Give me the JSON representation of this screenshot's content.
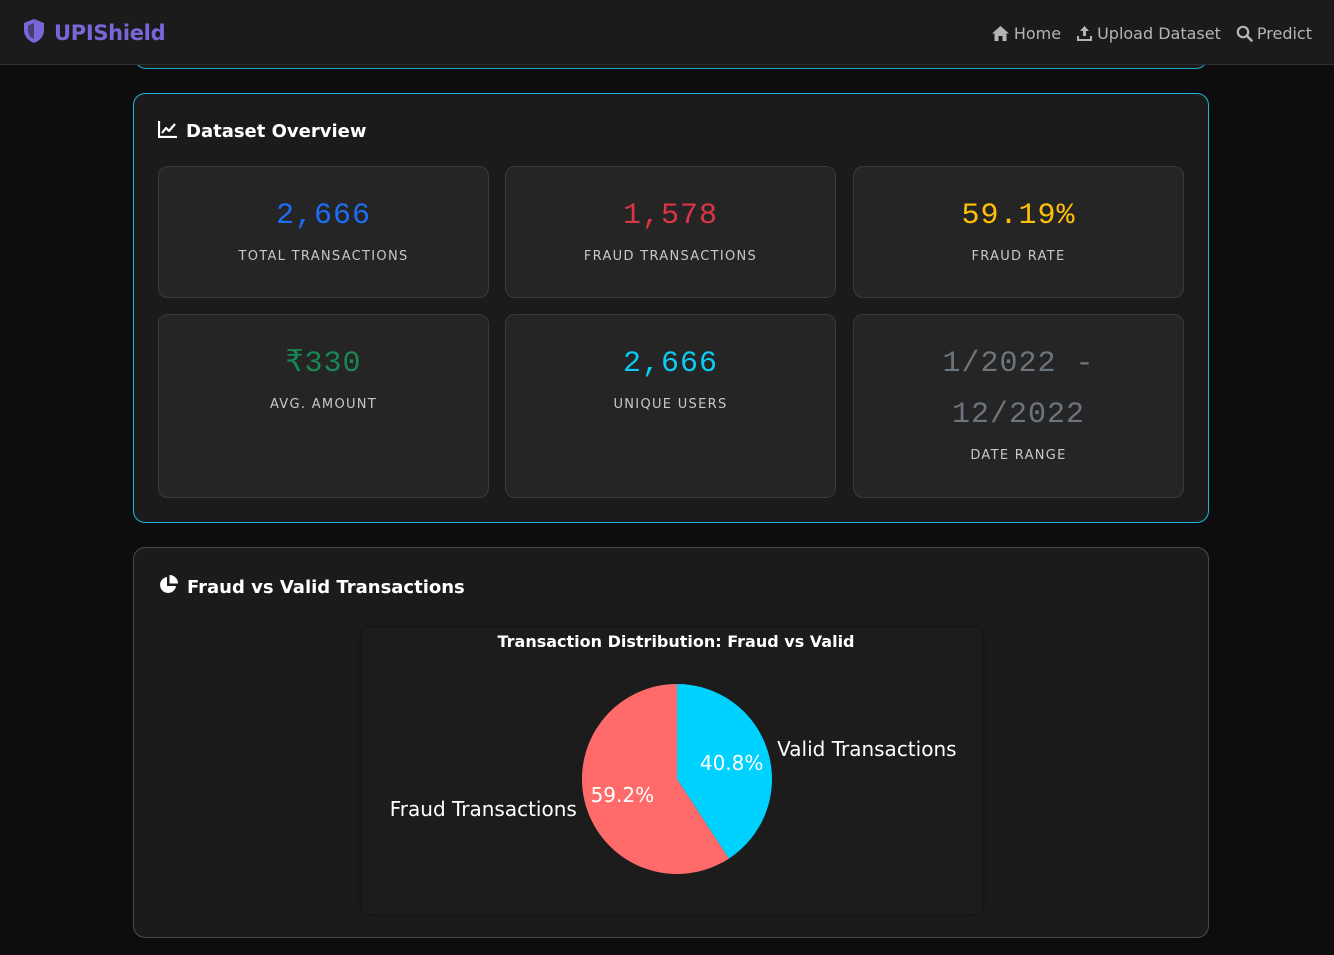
{
  "navbar": {
    "brand": "UPIShield",
    "links": [
      {
        "label": "Home",
        "icon": "home-icon"
      },
      {
        "label": "Upload Dataset",
        "icon": "upload-icon"
      },
      {
        "label": "Predict",
        "icon": "search-icon"
      }
    ]
  },
  "overview": {
    "title": "Dataset Overview",
    "icon": "line-chart-icon",
    "stats": [
      {
        "value": "2,666",
        "label": "TOTAL TRANSACTIONS",
        "color": "#1b6ef5"
      },
      {
        "value": "1,578",
        "label": "FRAUD TRANSACTIONS",
        "color": "#dc3545"
      },
      {
        "value": "59.19%",
        "label": "FRAUD RATE",
        "color": "#ffc107"
      },
      {
        "value": "₹330",
        "label": "AVG. AMOUNT",
        "color": "#198754"
      },
      {
        "value": "2,666",
        "label": "UNIQUE USERS",
        "color": "#0dcaf0"
      },
      {
        "value_line1": "1/2022 -",
        "value_line2": "12/2022",
        "label": "DATE RANGE",
        "color": "#6c757d"
      }
    ]
  },
  "chart_section": {
    "title": "Fraud vs Valid Transactions",
    "icon": "pie-chart-icon"
  },
  "chart_data": {
    "type": "pie",
    "title": "Transaction Distribution: Fraud vs Valid",
    "categories": [
      "Fraud Transactions",
      "Valid Transactions"
    ],
    "values": [
      59.2,
      40.8
    ],
    "percent_labels": [
      "59.2%",
      "40.8%"
    ],
    "colors": [
      "#ff6b6b",
      "#00d2ff"
    ]
  }
}
